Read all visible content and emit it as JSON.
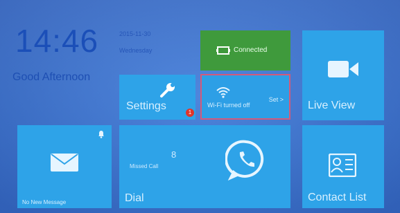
{
  "clock": {
    "time": "14:46",
    "greeting": "Good Afternoon",
    "date": "2015-11-30",
    "weekday": "Wednesday"
  },
  "tiles": {
    "connected": {
      "label": "Connected",
      "icon": "network-connected-icon"
    },
    "live_view": {
      "label": "Live View",
      "icon": "video-camera-icon"
    },
    "settings": {
      "label": "Settings",
      "icon": "wrench-icon",
      "badge": "1"
    },
    "wifi": {
      "status": "Wi-Fi turned off",
      "action": "Set >",
      "icon": "wifi-icon"
    },
    "message": {
      "label": "No New Message",
      "icon": "envelope-icon",
      "bell_icon": "bell-icon"
    },
    "dial": {
      "label": "Dial",
      "missed_label": "Missed Call",
      "missed_count": "8",
      "icon": "phone-icon"
    },
    "contacts": {
      "label": "Contact List",
      "icon": "contact-card-icon"
    }
  },
  "colors": {
    "tile_blue": "#2ea3e8",
    "connected_green": "#3f9a3c",
    "wifi_border": "#d45a7a",
    "badge_red": "#e0352b"
  }
}
